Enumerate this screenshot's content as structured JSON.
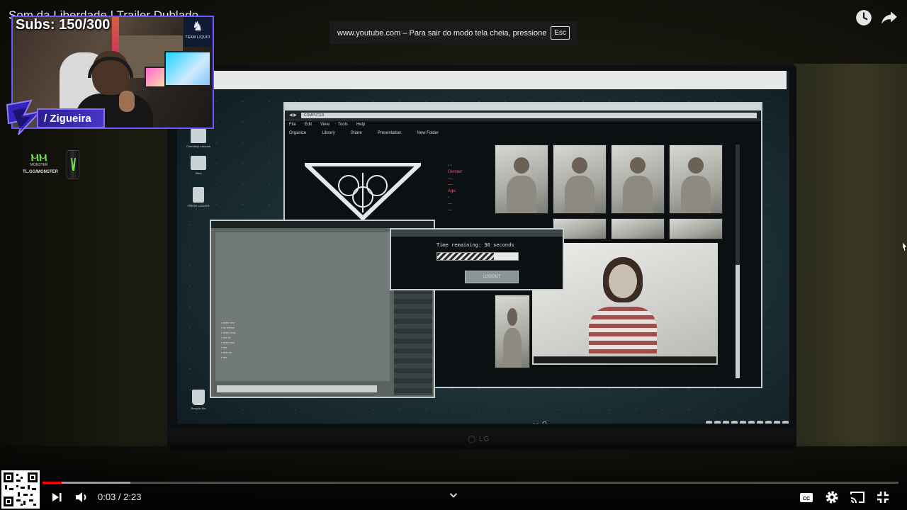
{
  "video": {
    "title": "Som da Liberdade | Trailer Dublado"
  },
  "fullscreen_notice": {
    "text": "www.youtube.com – Para sair do modo tela cheia, pressione",
    "key": "Esc"
  },
  "stream_overlay": {
    "subs_counter": "Subs: 150/300",
    "streamer_name": "/ Zigueira",
    "team_name": "TEAM LIQUID",
    "sponsor_word": "MONSTER",
    "sponsor_code": "TL.GG/MONSTER"
  },
  "desktop": {
    "icons": [
      {
        "label": "Chemistry Lessons"
      },
      {
        "label": "Sites"
      },
      {
        "label": "FRESH LOCKER"
      },
      {
        "label": "Recycle Bin"
      }
    ],
    "explorer": {
      "address": "COMPUTER",
      "menu": [
        "File",
        "Edit",
        "View",
        "Tools",
        "Help"
      ],
      "toolbar": [
        "Organize",
        "Library",
        "Share",
        "Presentation",
        "New Folder"
      ],
      "profile_lines": [
        "Gender:",
        "Age:"
      ]
    },
    "countdown": {
      "text": "Time remaining: 36 seconds",
      "progress": 0.7,
      "button": "LOGOUT"
    }
  },
  "player": {
    "time": "0:03 / 2:23",
    "progress_played": 0.022,
    "progress_loaded": 0.103,
    "icons": {
      "next": "next-icon",
      "volume": "volume-icon",
      "captions": "captions-icon",
      "settings": "gear-icon",
      "cast": "cast-icon",
      "exit_fullscreen": "exit-fullscreen-icon",
      "watch_later": "clock-icon",
      "share": "share-icon"
    }
  }
}
